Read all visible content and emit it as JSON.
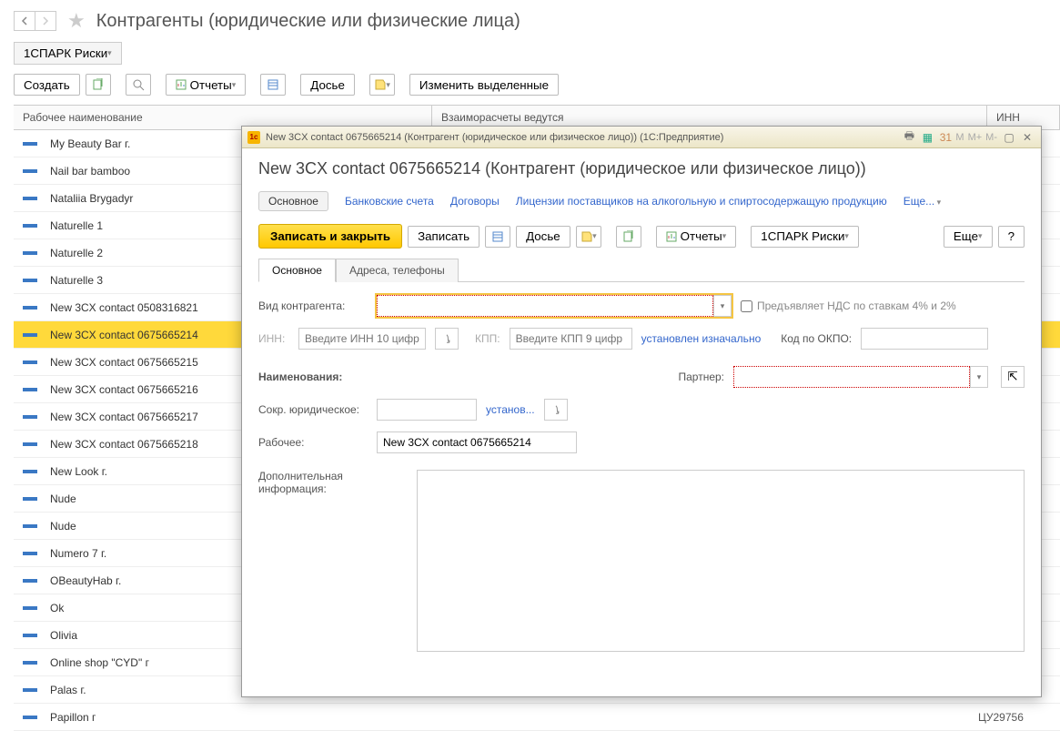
{
  "header": {
    "title": "Контрагенты (юридические или физические лица)"
  },
  "subheader": {
    "spark": "1СПАРК Риски"
  },
  "toolbar": {
    "create": "Создать",
    "reports": "Отчеты",
    "dossier": "Досье",
    "change_selected": "Изменить выделенные"
  },
  "table": {
    "col1": "Рабочее наименование",
    "col2": "Взаиморасчеты ведутся",
    "col3": "ИНН",
    "rows": [
      {
        "name": "My Beauty Bar г."
      },
      {
        "name": "Nail bar bamboo"
      },
      {
        "name": "Nataliia Brygadyr"
      },
      {
        "name": "Naturelle 1"
      },
      {
        "name": "Naturelle 2"
      },
      {
        "name": "Naturelle 3"
      },
      {
        "name": "New 3CX contact 0508316821"
      },
      {
        "name": "New 3CX contact 0675665214",
        "selected": true
      },
      {
        "name": "New 3CX contact 0675665215"
      },
      {
        "name": "New 3CX contact 0675665216"
      },
      {
        "name": "New 3CX contact 0675665217"
      },
      {
        "name": "New 3CX contact 0675665218"
      },
      {
        "name": "New Look  г."
      },
      {
        "name": "Nude"
      },
      {
        "name": "Nude"
      },
      {
        "name": "Numero 7   г."
      },
      {
        "name": "OBeautyHab  г."
      },
      {
        "name": "Ok"
      },
      {
        "name": "Olivia"
      },
      {
        "name": "Online shop \"CYD\" г"
      },
      {
        "name": "Palas г."
      },
      {
        "name": "Papillon г",
        "code": "ЦУ29756"
      }
    ]
  },
  "modal": {
    "wintitle": "New 3CX contact 0675665214 (Контрагент (юридическое или физическое лицо))  (1С:Предприятие)",
    "title": "New 3CX contact 0675665214 (Контрагент (юридическое или физическое лицо))",
    "sections": {
      "main": "Основное",
      "bank": "Банковские счета",
      "contracts": "Договоры",
      "licenses": "Лицензии поставщиков на алкогольную и спиртосодержащую продукцию",
      "more": "Еще..."
    },
    "toolbar": {
      "save_close": "Записать и закрыть",
      "save": "Записать",
      "dossier": "Досье",
      "reports": "Отчеты",
      "spark": "1СПАРК Риски",
      "more": "Еще",
      "help": "?"
    },
    "tabs": {
      "main": "Основное",
      "addresses": "Адреса, телефоны"
    },
    "form": {
      "type_label": "Вид контрагента:",
      "vat_checkbox": "Предъявляет НДС по ставкам 4% и 2%",
      "inn_label": "ИНН:",
      "inn_ph": "Введите ИНН 10 цифр",
      "kpp_label": "КПП:",
      "kpp_ph": "Введите КПП 9 цифр",
      "kpp_link": "установлен изначально",
      "okpo_label": "Код по ОКПО:",
      "names_label": "Наименования:",
      "partner_label": "Партнер:",
      "short_legal": "Сокр. юридическое:",
      "short_link": "установ...",
      "working_label": "Рабочее:",
      "working_value": "New 3CX contact 0675665214",
      "additional_label": "Дополнительная информация:"
    }
  }
}
